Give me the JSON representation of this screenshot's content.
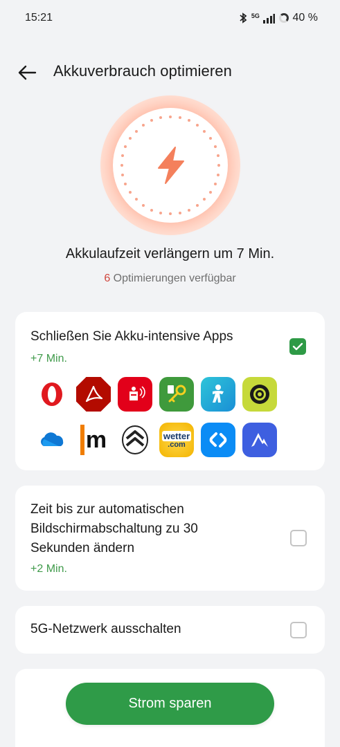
{
  "status_bar": {
    "time": "15:21",
    "network_label": "5G",
    "battery_percent": "40 %",
    "icons": [
      "bluetooth-icon",
      "signal-5g-icon",
      "battery-ring-icon"
    ]
  },
  "header": {
    "title": "Akkuverbrauch optimieren",
    "back_icon": "arrow-left-icon"
  },
  "hero": {
    "icon": "lightning-bolt-icon",
    "accent_color": "#f4805c"
  },
  "summary": {
    "headline": "Akkulaufzeit verlängern um 7 Min.",
    "count": "6",
    "subtitle_rest": " Optimierungen verfügbar"
  },
  "optimizations": [
    {
      "title": "Schließen Sie Akku-intensive Apps",
      "gain": "+7 Min.",
      "checked": true,
      "apps": [
        "opera-icon",
        "adobe-acrobat-icon",
        "sparkasse-icon",
        "keepass-icon",
        "fitness-app-icon",
        "podcast-app-icon",
        "onedrive-icon",
        "meinestadt-icon",
        "citroen-icon",
        "wetter-com-icon",
        "shazam-icon",
        "nordvpn-icon"
      ],
      "wetter_label_top": "wetter",
      "wetter_label_bottom": ".com",
      "m_label": "m"
    },
    {
      "title": "Zeit bis zur automatischen Bildschirmabschaltung zu 30 Sekunden ändern",
      "gain": "+2 Min.",
      "checked": false
    },
    {
      "title": "5G-Netzwerk ausschalten",
      "checked": false
    }
  ],
  "primary_button": {
    "label": "Strom sparen"
  },
  "colors": {
    "background": "#f2f3f5",
    "green": "#2f9b48",
    "gain_green": "#3f9a4a",
    "count_red": "#d0453c"
  }
}
